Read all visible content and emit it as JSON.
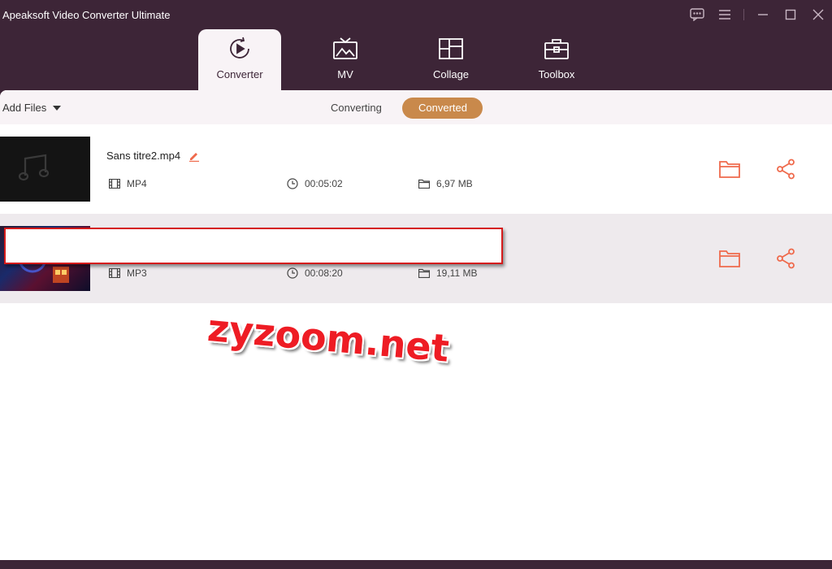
{
  "window": {
    "title": "Apeaksoft Video Converter Ultimate",
    "controls": [
      "feedback-icon",
      "menu-icon",
      "minimize-icon",
      "maximize-icon",
      "close-icon"
    ]
  },
  "nav": {
    "tabs": [
      {
        "label": "Converter",
        "icon": "converter-icon",
        "active": true
      },
      {
        "label": "MV",
        "icon": "tv-icon",
        "active": false
      },
      {
        "label": "Collage",
        "icon": "collage-icon",
        "active": false
      },
      {
        "label": "Toolbox",
        "icon": "toolbox-icon",
        "active": false
      }
    ]
  },
  "toolbar": {
    "add_files": "Add Files",
    "segments": {
      "converting": "Converting",
      "converted": "Converted",
      "selected": "Converted"
    }
  },
  "files": [
    {
      "name": "Sans titre2.mp4",
      "format": "MP4",
      "duration": "00:05:02",
      "size": "6,97 MB"
    },
    {
      "name": "",
      "format": "MP3",
      "duration": "00:08:20",
      "size": "19,11 MB"
    }
  ],
  "watermark": "zyzoom.net",
  "colors": {
    "titlebar": "#3d2537",
    "accent": "#c9894b",
    "action_icon": "#ef6a4c",
    "redaction_border": "#d51b1b",
    "watermark": "#ee1c24"
  }
}
